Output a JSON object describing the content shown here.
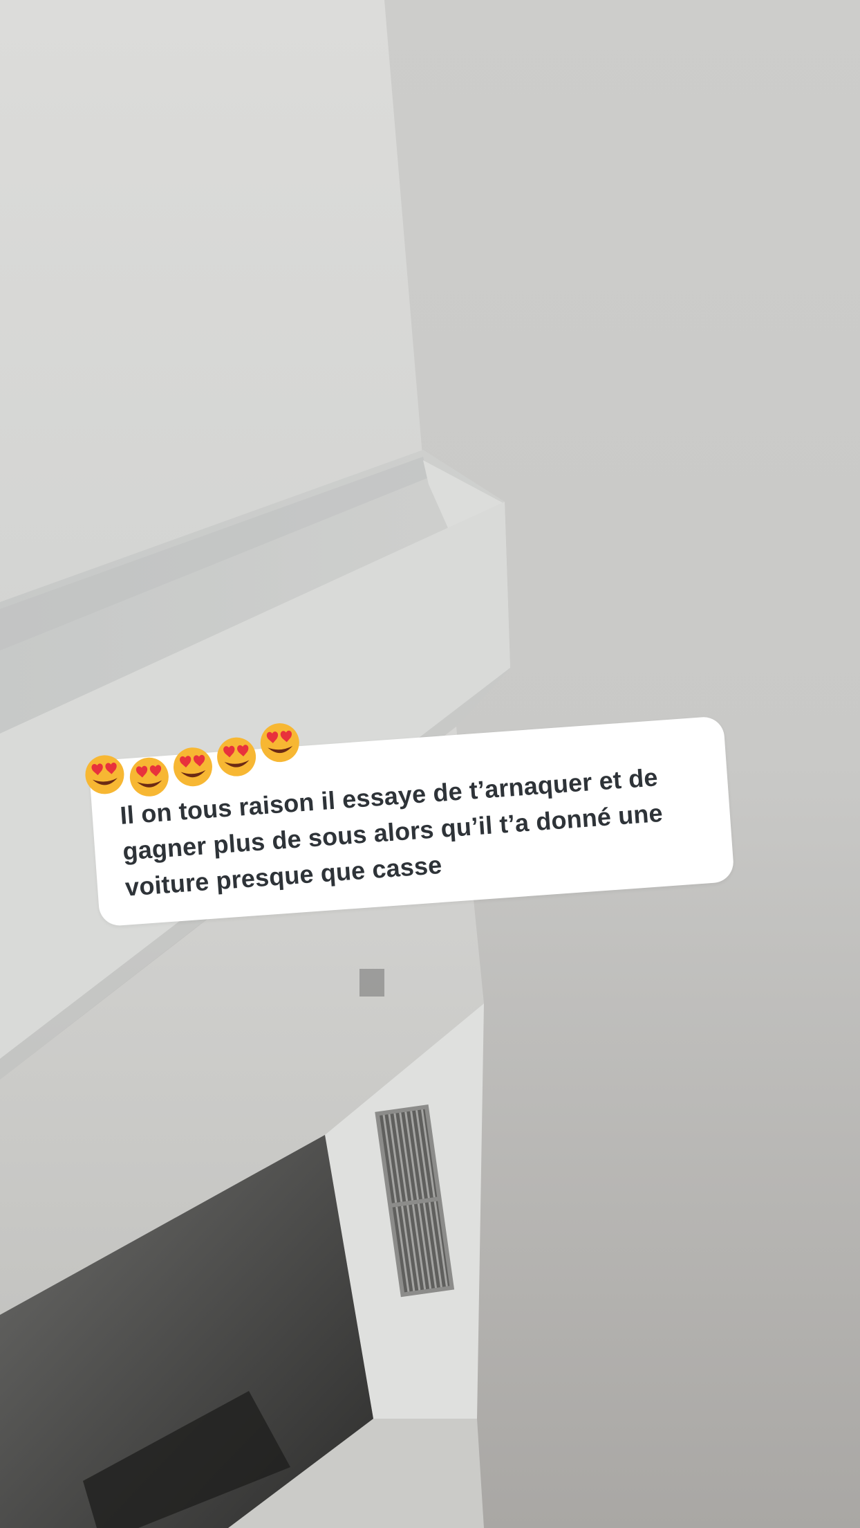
{
  "reply": {
    "username": "",
    "emoji_reactions": [
      "heart-eyes-face",
      "heart-eyes-face",
      "heart-eyes-face",
      "heart-eyes-face",
      "heart-eyes-face"
    ],
    "message": "Il on tous raison il essaye de t’arnaquer et de gagner plus de sous alors qu’il t’a donné une voiture presque que casse"
  },
  "colors": {
    "card_background": "#ffffff",
    "text": "#2e3338",
    "username": "#2aa0e8",
    "emoji_face": "#f7b733",
    "emoji_heart": "#e8323c"
  }
}
